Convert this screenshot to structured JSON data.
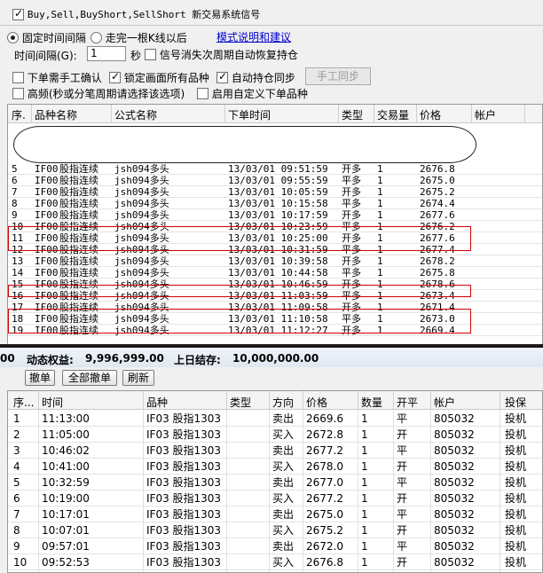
{
  "header": {
    "checkbox_label": "Buy,Sell,BuyShort,SellShort 新交易系统信号"
  },
  "options": {
    "radio_fixed_label": "固定时间间隔",
    "radio_bar_label": "走完一根K线以后",
    "help_link": "模式说明和建议",
    "interval_label": "时间间隔(G):",
    "interval_value": "1",
    "interval_unit": "秒",
    "restore_label": "信号消失次周期自动恢复持仓",
    "manual_confirm_label": "下单需手工确认",
    "lock_label": "锁定画面所有品种",
    "auto_sync_label": "自动持仓同步",
    "manual_sync_button": "手工同步",
    "hf_label": "高频(秒或分笔周期请选择该选项)",
    "custom_order_label": "启用自定义下单品种"
  },
  "signals_table": {
    "headers": [
      "序.",
      "品种名称",
      "公式名称",
      "下单时间",
      "类型",
      "交易量",
      "价格",
      "帐户"
    ],
    "rows": [
      {
        "no": "5",
        "code": "IF00",
        "name": "股指连续",
        "formula": "jsh094多头",
        "time": "13/03/01 09:51:59",
        "type": "开多",
        "qty": "1",
        "price": "2676.8"
      },
      {
        "no": "6",
        "code": "IF00",
        "name": "股指连续",
        "formula": "jsh094多头",
        "time": "13/03/01 09:55:59",
        "type": "平多",
        "qty": "1",
        "price": "2675.0"
      },
      {
        "no": "7",
        "code": "IF00",
        "name": "股指连续",
        "formula": "jsh094多头",
        "time": "13/03/01 10:05:59",
        "type": "开多",
        "qty": "1",
        "price": "2675.2"
      },
      {
        "no": "8",
        "code": "IF00",
        "name": "股指连续",
        "formula": "jsh094多头",
        "time": "13/03/01 10:15:58",
        "type": "平多",
        "qty": "1",
        "price": "2674.4"
      },
      {
        "no": "9",
        "code": "IF00",
        "name": "股指连续",
        "formula": "jsh094多头",
        "time": "13/03/01 10:17:59",
        "type": "开多",
        "qty": "1",
        "price": "2677.6"
      },
      {
        "no": "10",
        "code": "IF00",
        "name": "股指连续",
        "formula": "jsh094多头",
        "time": "13/03/01 10:23:59",
        "type": "平多",
        "qty": "1",
        "price": "2676.2"
      },
      {
        "no": "11",
        "code": "IF00",
        "name": "股指连续",
        "formula": "jsh094多头",
        "time": "13/03/01 10:25:00",
        "type": "开多",
        "qty": "1",
        "price": "2677.6"
      },
      {
        "no": "12",
        "code": "IF00",
        "name": "股指连续",
        "formula": "jsh094多头",
        "time": "13/03/01 10:31:59",
        "type": "平多",
        "qty": "1",
        "price": "2677.4"
      },
      {
        "no": "13",
        "code": "IF00",
        "name": "股指连续",
        "formula": "jsh094多头",
        "time": "13/03/01 10:39:58",
        "type": "开多",
        "qty": "1",
        "price": "2678.2"
      },
      {
        "no": "14",
        "code": "IF00",
        "name": "股指连续",
        "formula": "jsh094多头",
        "time": "13/03/01 10:44:58",
        "type": "平多",
        "qty": "1",
        "price": "2675.8"
      },
      {
        "no": "15",
        "code": "IF00",
        "name": "股指连续",
        "formula": "jsh094多头",
        "time": "13/03/01 10:46:59",
        "type": "开多",
        "qty": "1",
        "price": "2678.6"
      },
      {
        "no": "16",
        "code": "IF00",
        "name": "股指连续",
        "formula": "jsh094多头",
        "time": "13/03/01 11:03:59",
        "type": "平多",
        "qty": "1",
        "price": "2673.4"
      },
      {
        "no": "17",
        "code": "IF00",
        "name": "股指连续",
        "formula": "jsh094多头",
        "time": "13/03/01 11:09:58",
        "type": "开多",
        "qty": "1",
        "price": "2671.4"
      },
      {
        "no": "18",
        "code": "IF00",
        "name": "股指连续",
        "formula": "jsh094多头",
        "time": "13/03/01 11:10:58",
        "type": "平多",
        "qty": "1",
        "price": "2673.0"
      },
      {
        "no": "19",
        "code": "IF00",
        "name": "股指连续",
        "formula": "jsh094多头",
        "time": "13/03/01 11:12:27",
        "type": "开多",
        "qty": "1",
        "price": "2669.4"
      }
    ]
  },
  "status_bar": {
    "left_fragment": "00",
    "equity_label": "动态权益:",
    "equity_value": "9,996,999.00",
    "prev_label": "上日结存:",
    "prev_value": "10,000,000.00"
  },
  "order_buttons": {
    "cancel": "撤单",
    "cancel_all": "全部撤单",
    "refresh": "刷新"
  },
  "orders_table": {
    "headers": [
      "序...",
      "时间",
      "品种",
      "类型",
      "方向",
      "价格",
      "数量",
      "开平",
      "帐户",
      "投保"
    ],
    "rows": [
      {
        "no": "1",
        "time": "11:13:00",
        "symbol": "IF03 股指1303",
        "type": "",
        "dir": "卖出",
        "price": "2669.6",
        "qty": "1",
        "oc": "平",
        "acct": "805032",
        "hedge": "投机"
      },
      {
        "no": "2",
        "time": "11:05:00",
        "symbol": "IF03 股指1303",
        "type": "",
        "dir": "买入",
        "price": "2672.8",
        "qty": "1",
        "oc": "开",
        "acct": "805032",
        "hedge": "投机"
      },
      {
        "no": "3",
        "time": "10:46:02",
        "symbol": "IF03 股指1303",
        "type": "",
        "dir": "卖出",
        "price": "2677.2",
        "qty": "1",
        "oc": "平",
        "acct": "805032",
        "hedge": "投机"
      },
      {
        "no": "4",
        "time": "10:41:00",
        "symbol": "IF03 股指1303",
        "type": "",
        "dir": "买入",
        "price": "2678.0",
        "qty": "1",
        "oc": "开",
        "acct": "805032",
        "hedge": "投机"
      },
      {
        "no": "5",
        "time": "10:32:59",
        "symbol": "IF03 股指1303",
        "type": "",
        "dir": "卖出",
        "price": "2677.0",
        "qty": "1",
        "oc": "平",
        "acct": "805032",
        "hedge": "投机"
      },
      {
        "no": "6",
        "time": "10:19:00",
        "symbol": "IF03 股指1303",
        "type": "",
        "dir": "买入",
        "price": "2677.2",
        "qty": "1",
        "oc": "开",
        "acct": "805032",
        "hedge": "投机"
      },
      {
        "no": "7",
        "time": "10:17:01",
        "symbol": "IF03 股指1303",
        "type": "",
        "dir": "卖出",
        "price": "2675.0",
        "qty": "1",
        "oc": "平",
        "acct": "805032",
        "hedge": "投机"
      },
      {
        "no": "8",
        "time": "10:07:01",
        "symbol": "IF03 股指1303",
        "type": "",
        "dir": "买入",
        "price": "2675.2",
        "qty": "1",
        "oc": "开",
        "acct": "805032",
        "hedge": "投机"
      },
      {
        "no": "9",
        "time": "09:57:01",
        "symbol": "IF03 股指1303",
        "type": "",
        "dir": "卖出",
        "price": "2672.0",
        "qty": "1",
        "oc": "平",
        "acct": "805032",
        "hedge": "投机"
      },
      {
        "no": "10",
        "time": "09:52:53",
        "symbol": "IF03 股指1303",
        "type": "",
        "dir": "买入",
        "price": "2676.8",
        "qty": "1",
        "oc": "开",
        "acct": "805032",
        "hedge": "投机"
      }
    ]
  },
  "colors": {
    "highlight_border": "#d00000",
    "link": "#0000cc"
  }
}
